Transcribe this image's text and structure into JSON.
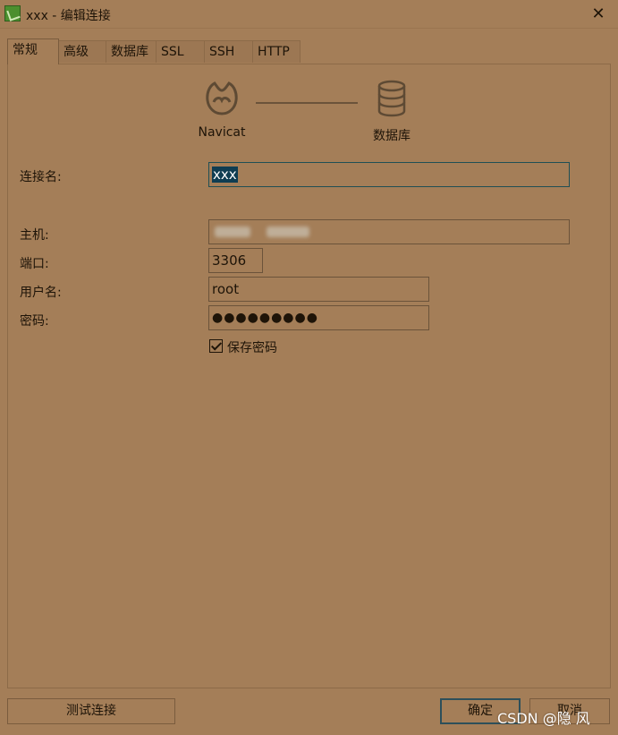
{
  "window": {
    "title": "xxx - 编辑连接",
    "close_glyph": "✕",
    "app_icon": "navicat-app-icon"
  },
  "tabs": [
    {
      "label": "常规",
      "active": true
    },
    {
      "label": "高级",
      "active": false
    },
    {
      "label": "数据库",
      "active": false
    },
    {
      "label": "SSL",
      "active": false
    },
    {
      "label": "SSH",
      "active": false
    },
    {
      "label": "HTTP",
      "active": false
    }
  ],
  "diagram": {
    "left_label": "Navicat",
    "left_icon": "navicat-logo-icon",
    "right_label": "数据库",
    "right_icon": "database-icon"
  },
  "form": {
    "connection_name_label": "连接名:",
    "connection_name_value": "xxx",
    "host_label": "主机:",
    "host_value": "",
    "port_label": "端口:",
    "port_value": "3306",
    "user_label": "用户名:",
    "user_value": "root",
    "password_label": "密码:",
    "password_value": "●●●●●●●●●",
    "save_password_label": "保存密码",
    "save_password_checked": true
  },
  "footer": {
    "test_button": "测试连接",
    "ok_button": "确定",
    "cancel_button": "取消"
  },
  "watermark": "CSDN @隐 风",
  "colors": {
    "background": "#a47e58",
    "text": "#1e1408",
    "selection": "#0f3d52",
    "focus_border": "#1f4f55"
  }
}
